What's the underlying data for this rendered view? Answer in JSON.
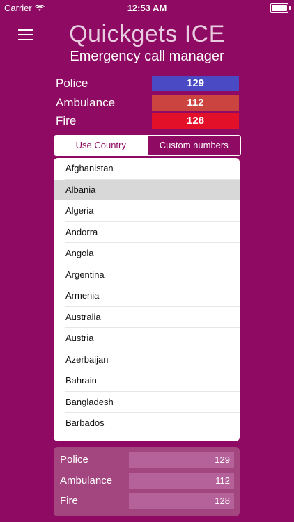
{
  "status": {
    "carrier": "Carrier",
    "time": "12:53 AM"
  },
  "header": {
    "title": "Quickgets ICE",
    "subtitle": "Emergency call manager"
  },
  "numbers": [
    {
      "label": "Police",
      "value": "129",
      "color": "#4a4ac4"
    },
    {
      "label": "Ambulance",
      "value": "112",
      "color": "#cc4440"
    },
    {
      "label": "Fire",
      "value": "128",
      "color": "#e3102a"
    }
  ],
  "segment": {
    "left": "Use Country",
    "right": "Custom numbers"
  },
  "countries": [
    "Afghanistan",
    "Albania",
    "Algeria",
    "Andorra",
    "Angola",
    "Argentina",
    "Armenia",
    "Australia",
    "Austria",
    "Azerbaijan",
    "Bahrain",
    "Bangladesh",
    "Barbados"
  ],
  "selected_country": "Albania",
  "bottom": [
    {
      "label": "Police",
      "value": "129"
    },
    {
      "label": "Ambulance",
      "value": "112"
    },
    {
      "label": "Fire",
      "value": "128"
    }
  ]
}
